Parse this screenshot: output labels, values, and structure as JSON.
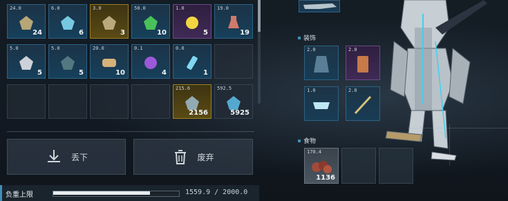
{
  "inventory": {
    "slots": [
      {
        "weight": "24.0",
        "qty": "24",
        "icon": "gear-part-icon",
        "color": "#c9b27a"
      },
      {
        "weight": "6.0",
        "qty": "6",
        "icon": "crystal-shard-icon",
        "color": "#7fd8f0"
      },
      {
        "weight": "3.0",
        "qty": "3",
        "icon": "scrap-metal-icon",
        "color": "#c8b48a"
      },
      {
        "weight": "50.0",
        "qty": "10",
        "icon": "green-gem-icon",
        "color": "#4fd05a"
      },
      {
        "weight": "1.0",
        "qty": "5",
        "icon": "energy-orb-icon",
        "color": "#f2d541"
      },
      {
        "weight": "19.0",
        "qty": "19",
        "icon": "potion-bottle-icon",
        "color": "#d07a6a"
      },
      {
        "weight": "5.0",
        "qty": "5",
        "icon": "quartz-icon",
        "color": "#e2e2e8"
      },
      {
        "weight": "5.0",
        "qty": "5",
        "icon": "ore-pile-icon",
        "color": "#5a7f86"
      },
      {
        "weight": "20.0",
        "qty": "10",
        "icon": "scroll-icon",
        "color": "#d6b27a"
      },
      {
        "weight": "0.1",
        "qty": "4",
        "icon": "purple-orb-icon",
        "color": "#9a5ad8"
      },
      {
        "weight": "0.0",
        "qty": "1",
        "icon": "injector-icon",
        "color": "#7fd8f0"
      },
      {
        "weight": "",
        "qty": "",
        "icon": "",
        "color": ""
      },
      {
        "weight": "",
        "qty": "",
        "icon": "",
        "color": ""
      },
      {
        "weight": "",
        "qty": "",
        "icon": "",
        "color": ""
      },
      {
        "weight": "",
        "qty": "",
        "icon": "",
        "color": ""
      },
      {
        "weight": "",
        "qty": "",
        "icon": "",
        "color": ""
      },
      {
        "weight": "215.6",
        "qty": "2156",
        "icon": "metal-chunk-icon",
        "color": "#9ab6c4"
      },
      {
        "weight": "592.5",
        "qty": "5925",
        "icon": "crystal-ore-icon",
        "color": "#5ab6e0"
      }
    ]
  },
  "actions": {
    "drop_label": "丢下",
    "discard_label": "废弃"
  },
  "weight": {
    "label": "负重上限",
    "text": "1559.9 / 2000.0",
    "fraction": 0.78
  },
  "equipment": {
    "accessories_title": "装饰",
    "accessories": [
      {
        "weight": "2.0",
        "icon": "armor-suit-icon"
      },
      {
        "weight": "2.0",
        "icon": "tarot-card-icon"
      },
      {
        "weight": "1.0",
        "icon": "visor-goggles-icon"
      },
      {
        "weight": "2.0",
        "icon": "spear-icon"
      }
    ],
    "food_title": "食物",
    "food": [
      {
        "weight": "170.4",
        "qty": "1136",
        "icon": "meat-icon"
      }
    ]
  }
}
